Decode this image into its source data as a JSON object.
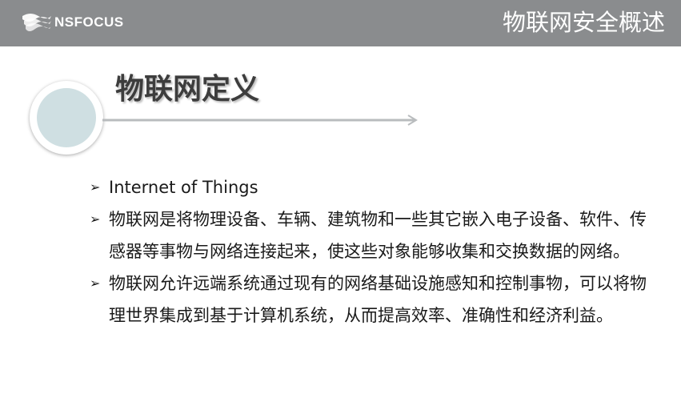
{
  "header": {
    "logo_text": "NSFOCUS",
    "title": "物联网安全概述",
    "background_color": "#8a8c8e"
  },
  "section": {
    "title": "物联网定义"
  },
  "bullets": [
    {
      "text": "Internet of Things"
    },
    {
      "text": "物联网是将物理设备、车辆、建筑物和一些其它嵌入电子设备、软件、传感器等事物与网络连接起来，使这些对象能够收集和交换数据的网络。"
    },
    {
      "text": "物联网允许远端系统通过现有的网络基础设施感知和控制事物，可以将物理世界集成到基于计算机系统，从而提高效率、准确性和经济利益。"
    }
  ],
  "icons": {
    "bullet_marker": "arrow-bullet-icon",
    "logo": "nsfocus-flag-icon",
    "decoration": "circle-icon"
  }
}
